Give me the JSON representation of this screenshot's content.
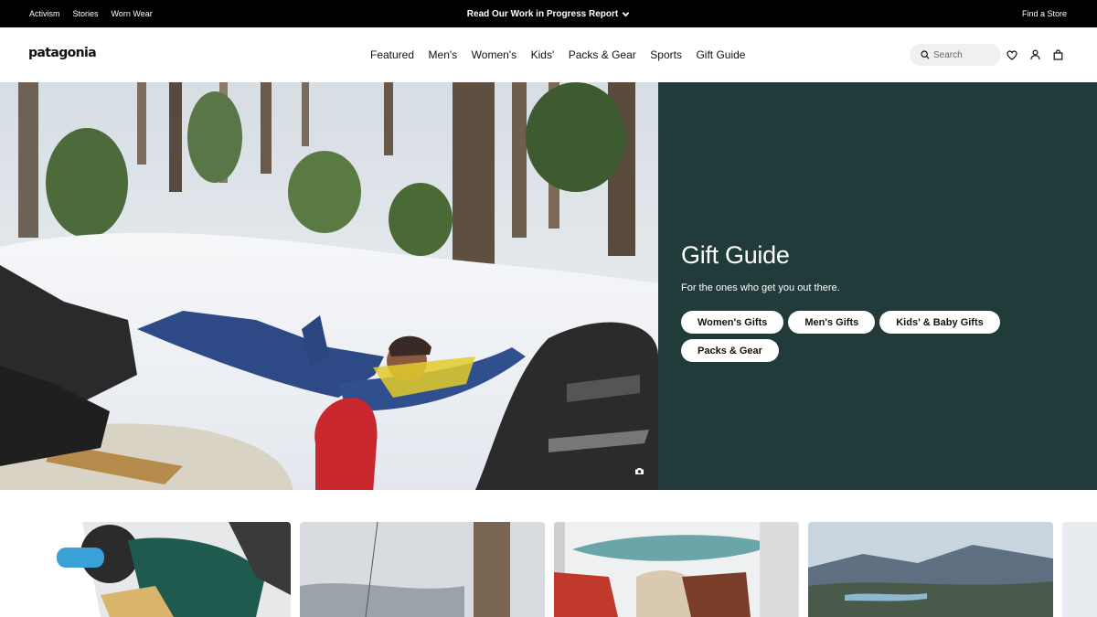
{
  "utility_bar": {
    "links": [
      "Activism",
      "Stories",
      "Worn Wear"
    ],
    "promo": "Read Our Work in Progress Report",
    "find_store": "Find a Store"
  },
  "header": {
    "logo": "patagonia",
    "nav": [
      "Featured",
      "Men's",
      "Women's",
      "Kids'",
      "Packs & Gear",
      "Sports",
      "Gift Guide"
    ],
    "search_placeholder": "Search",
    "icons": [
      "heart-icon",
      "account-icon",
      "bag-icon"
    ]
  },
  "hero": {
    "title": "Gift Guide",
    "subtitle": "For the ones who get you out there.",
    "buttons": [
      "Women's Gifts",
      "Men's Gifts",
      "Kids' & Baby Gifts",
      "Packs & Gear"
    ],
    "panel_color": "#203b3a",
    "photo_credit_icon": "camera-icon"
  },
  "cards": [
    "snowboarder-photo",
    "snowy-forest-photo",
    "surfboard-carry-photo",
    "mountain-lake-photo"
  ]
}
